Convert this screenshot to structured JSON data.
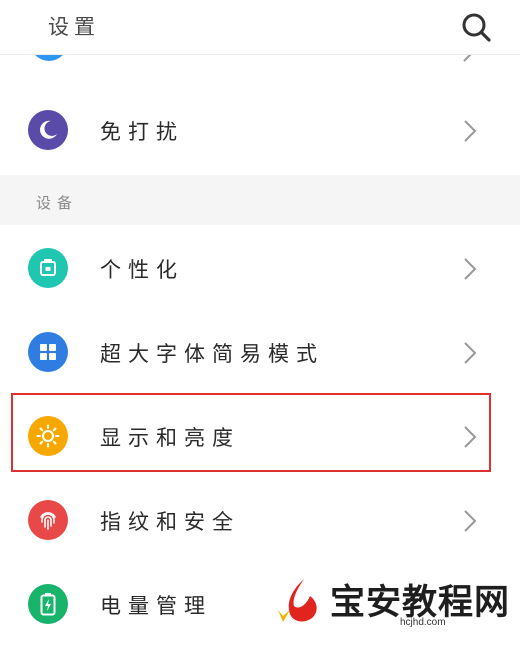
{
  "header": {
    "title": "设置",
    "search_icon": "search-icon"
  },
  "settings": {
    "rows": [
      {
        "label": "免打扰",
        "icon": "moon-icon",
        "color": "#5a4ba8"
      },
      {
        "label": "个性化",
        "icon": "personalization-icon",
        "color": "#1fc6b0"
      },
      {
        "label": "超大字体简易模式",
        "icon": "grid-icon",
        "color": "#2f7de1"
      },
      {
        "label": "显示和亮度",
        "icon": "sun-icon",
        "color": "#f6a800",
        "highlighted": true
      },
      {
        "label": "指纹和安全",
        "icon": "fingerprint-icon",
        "color": "#e94848"
      },
      {
        "label": "电量管理",
        "icon": "battery-icon",
        "color": "#18b46b"
      }
    ]
  },
  "section": {
    "device_label": "设备"
  },
  "watermark": {
    "text": "宝安教程网",
    "domain": "hcjhd.com"
  },
  "colors": {
    "accent_red": "#e0312f",
    "band": "#f5f5f5"
  }
}
